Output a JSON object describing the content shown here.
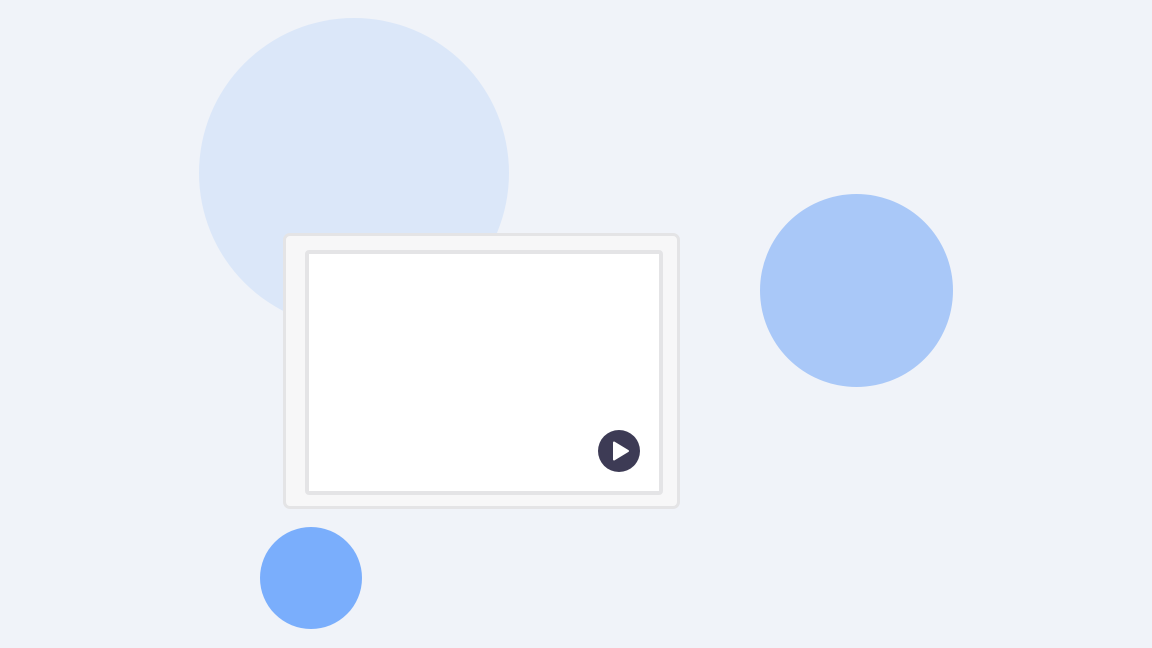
{
  "theme": {
    "background": "#f0f3f9",
    "circle_large": "#dbe7f9",
    "circle_medium": "#a9c8f8",
    "circle_small": "#7aaefc",
    "frame_outer_fill": "#f7f7f8",
    "frame_outer_border": "#e4e4e6",
    "frame_inner_fill": "#ffffff",
    "frame_inner_border": "#e4e4e6",
    "play_button_fill": "#3d3b55",
    "play_icon_fill": "#ffffff"
  },
  "player": {
    "play_icon": "play-icon"
  }
}
